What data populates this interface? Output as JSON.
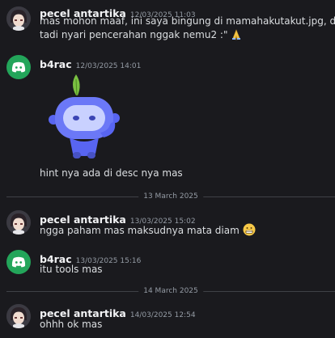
{
  "messages": [
    {
      "author": "pecel antartika",
      "timestamp": "12/03/2025 11:03",
      "lines": [
        "mas mohon maaf, ini saya bingung di mamahakutakut.jpg, dari",
        "tadi nyari pencerahan nggak nemu2 :\""
      ]
    },
    {
      "author": "b4rac",
      "timestamp": "12/03/2025 14:01",
      "text": "hint nya ada di desc nya mas"
    },
    {
      "author": "pecel antartika",
      "timestamp": "13/03/2025 15:02",
      "text": "ngga paham mas maksudnya mata diam"
    },
    {
      "author": "b4rac",
      "timestamp": "13/03/2025 15:16",
      "text": "itu tools mas"
    },
    {
      "author": "pecel antartika",
      "timestamp": "14/03/2025 12:54",
      "text": "ohhh ok mas"
    }
  ],
  "dividers": [
    "13 March 2025",
    "14 March 2025"
  ],
  "icons": {
    "pray": "pray-emoji",
    "grimace": "grimacing-emoji",
    "sticker": "discord-mascot-sticker"
  },
  "colors": {
    "background": "#1a1a1e",
    "bot_avatar": "#23a55a",
    "sticker_blue": "#5865f2",
    "leaf": "#7ac142"
  }
}
